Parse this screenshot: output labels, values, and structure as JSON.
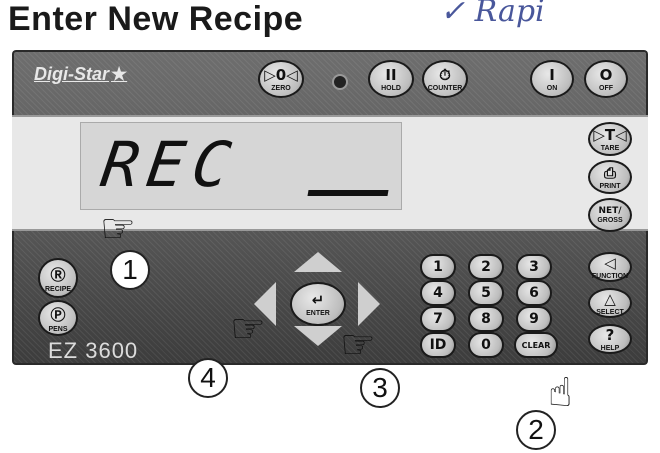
{
  "page": {
    "title": "Enter New Recipe",
    "handwriting": "✓ Rapi"
  },
  "device": {
    "brand": "Digi-Star",
    "model": "EZ 3600",
    "display_text": "REC",
    "top_buttons": [
      {
        "name": "zero",
        "symbol": "▷0◁",
        "label": "ZERO"
      },
      {
        "name": "hold",
        "symbol": "II",
        "label": "HOLD"
      },
      {
        "name": "counter",
        "symbol": "⏱",
        "label": "COUNTER"
      },
      {
        "name": "on",
        "symbol": "I",
        "label": "ON"
      },
      {
        "name": "off",
        "symbol": "O",
        "label": "OFF"
      }
    ],
    "display_side_buttons": [
      {
        "name": "tare",
        "symbol": "▷T◁",
        "label": "TARE"
      },
      {
        "name": "print",
        "symbol": "⎙",
        "label": "PRINT"
      },
      {
        "name": "net-gross",
        "symbol": "NET/",
        "label": "GROSS"
      }
    ],
    "left_buttons": [
      {
        "name": "recipe",
        "symbol": "Ⓡ",
        "label": "RECIPE"
      },
      {
        "name": "pens",
        "symbol": "Ⓟ",
        "label": "PENS"
      }
    ],
    "enter_label": "ENTER",
    "keypad": [
      [
        "1",
        "2",
        "3"
      ],
      [
        "4",
        "5",
        "6"
      ],
      [
        "7",
        "8",
        "9"
      ],
      [
        "ID",
        "0",
        "CLEAR"
      ]
    ],
    "right_buttons": [
      {
        "name": "function",
        "symbol": "◁",
        "label": "FUNCTION"
      },
      {
        "name": "select",
        "symbol": "△",
        "label": "SELECT"
      },
      {
        "name": "help",
        "symbol": "?",
        "label": "HELP"
      }
    ]
  },
  "callouts": [
    "1",
    "2",
    "3",
    "4"
  ]
}
